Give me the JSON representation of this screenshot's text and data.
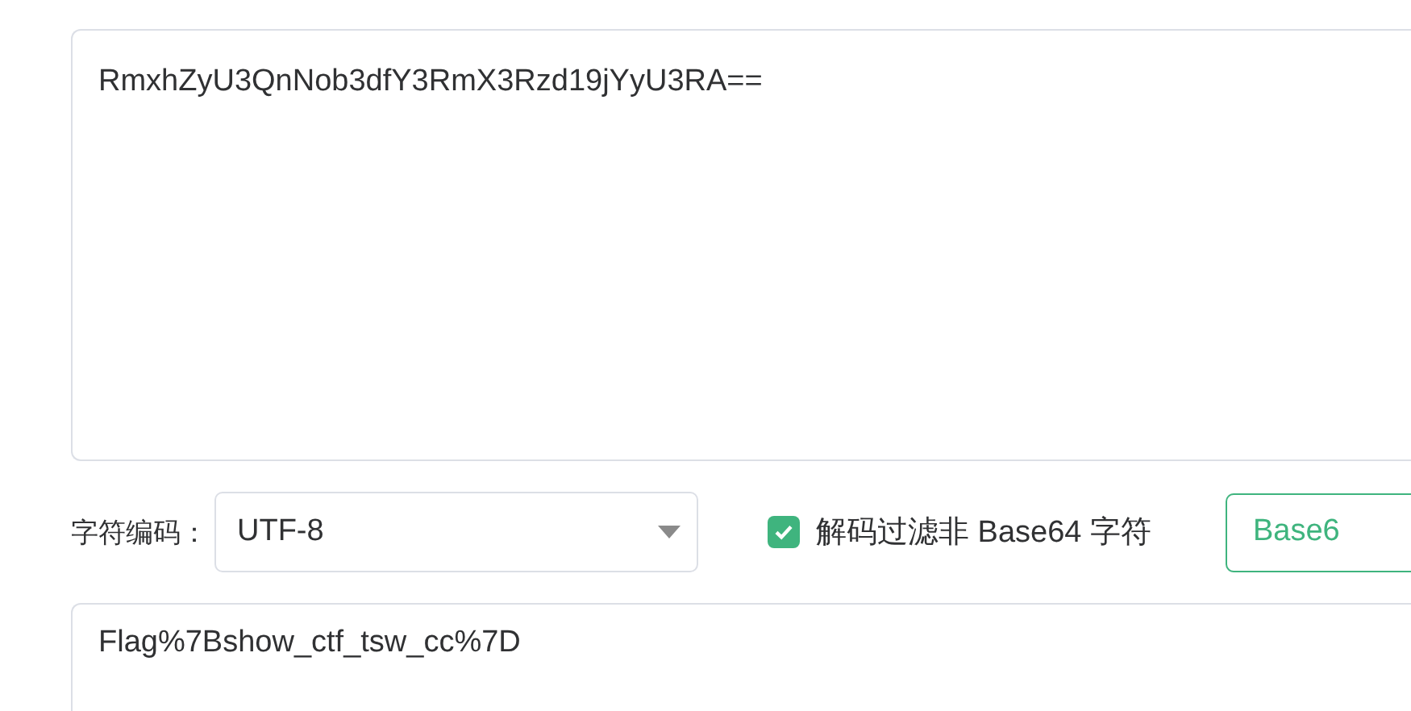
{
  "input_text": {
    "value": "RmxhZyU3QnNob3dfY3RmX3Rzd19jYyU3RA=="
  },
  "options": {
    "charset_label": "字符编码：",
    "charset_value": "UTF-8",
    "filter_checkbox": {
      "label": "解码过滤非 Base64 字符",
      "checked": true
    },
    "button": "Base6"
  },
  "output_text": {
    "value": "Flag%7Bshow_ctf_tsw_cc%7D"
  }
}
